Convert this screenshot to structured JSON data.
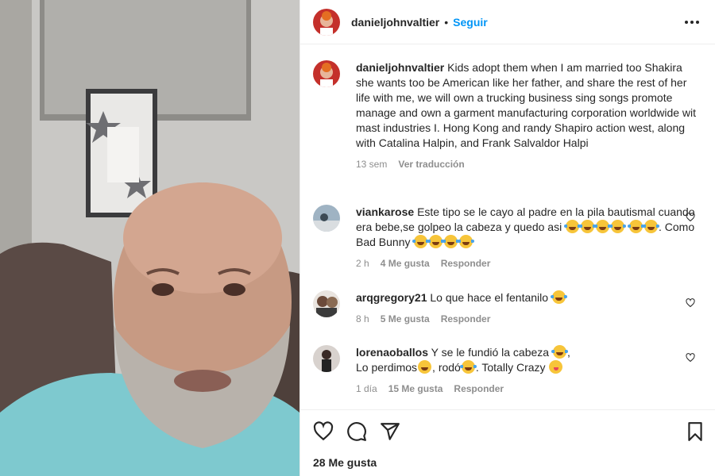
{
  "post": {
    "username": "danieljohnvaltier",
    "separator": "•",
    "follow_label": "Seguir",
    "more_icon": "more-options-icon"
  },
  "caption": {
    "username": "danieljohnvaltier",
    "text": "Kids adopt them when I am married too Shakira she wants too be American like her father, and share the rest of her life with me, we will own a trucking business sing songs promote manage and own a garment manufacturing corporation worldwide wit mast industries I. Hong Kong and randy Shapiro action west, along with Catalina Halpin, and Frank Salvaldor Halpi",
    "time": "13 sem",
    "translate_label": "Ver traducción"
  },
  "comments": [
    {
      "username": "viankarose",
      "text_1": "Este tipo se le cayo al padre en la pila bautismal cuando era bebe,se golpeo la cabeza y quedo asi",
      "text_2": ". Como Bad Bunny",
      "time": "2 h",
      "likes": "4 Me gusta",
      "reply": "Responder"
    },
    {
      "username": "arqgregory21",
      "text_1": "Lo que hace el fentanilo",
      "time": "8 h",
      "likes": "5 Me gusta",
      "reply": "Responder"
    },
    {
      "username": "lorenaoballos",
      "text_1": "Y se le fundió la cabeza",
      "text_2": "Lo perdimos",
      "text_3": ", rodó",
      "text_4": ". Totally Crazy",
      "time": "1 día",
      "likes": "15 Me gusta",
      "reply": "Responder"
    }
  ],
  "footer": {
    "likes": "28 Me gusta"
  },
  "colors": {
    "accent": "#0095f6",
    "secondary_text": "#8e8e8e",
    "border": "#efefef"
  }
}
